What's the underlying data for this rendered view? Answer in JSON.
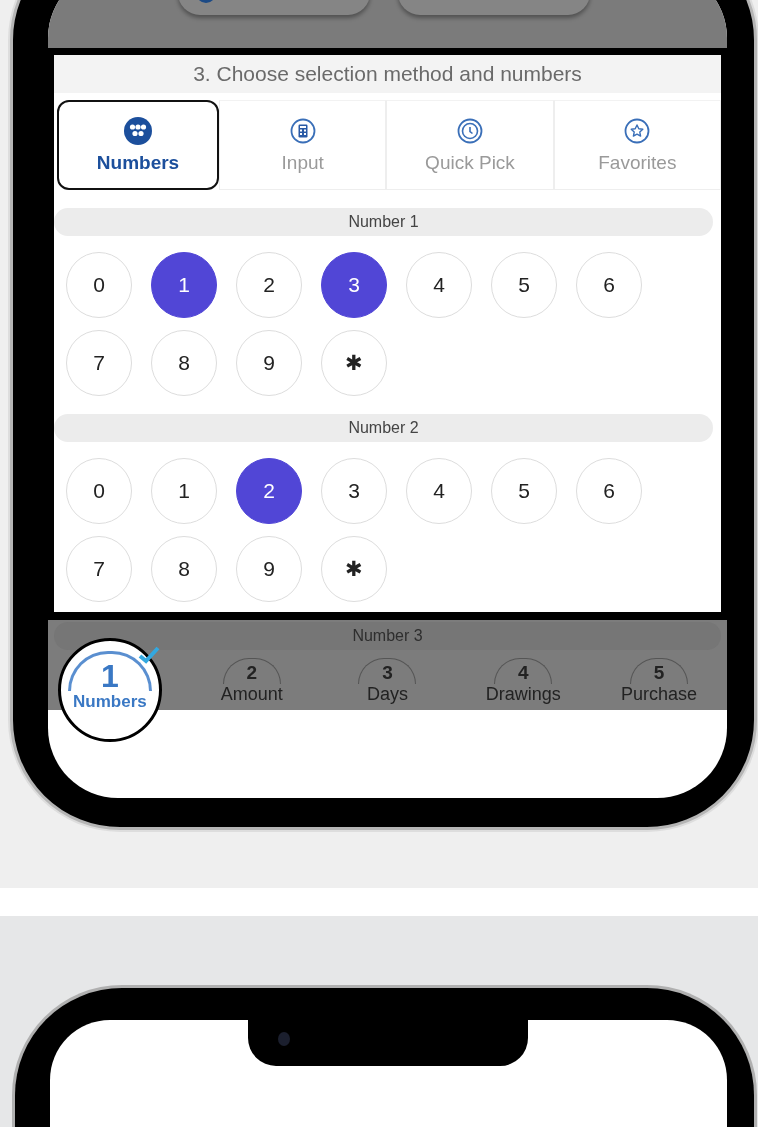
{
  "dimmed_top": {
    "buttons": [
      {
        "kind": "icon"
      },
      {
        "kind": "plain"
      }
    ]
  },
  "highlighted_section": {
    "title": "3. Choose selection method and numbers",
    "tabs": [
      {
        "label": "Numbers",
        "kind": "numbers",
        "selected": true
      },
      {
        "label": "Input",
        "kind": "input",
        "selected": false
      },
      {
        "label": "Quick Pick",
        "kind": "quick_pick",
        "selected": false
      },
      {
        "label": "Favorites",
        "kind": "favorites",
        "selected": false
      }
    ],
    "number_groups": [
      {
        "label": "Number 1",
        "options": [
          {
            "label": "0",
            "selected": false
          },
          {
            "label": "1",
            "selected": true
          },
          {
            "label": "2",
            "selected": false
          },
          {
            "label": "3",
            "selected": true
          },
          {
            "label": "4",
            "selected": false
          },
          {
            "label": "5",
            "selected": false
          },
          {
            "label": "6",
            "selected": false
          },
          {
            "label": "7",
            "selected": false
          },
          {
            "label": "8",
            "selected": false
          },
          {
            "label": "9",
            "selected": false
          },
          {
            "label": "✱",
            "selected": false
          }
        ]
      },
      {
        "label": "Number 2",
        "options": [
          {
            "label": "0",
            "selected": false
          },
          {
            "label": "1",
            "selected": false
          },
          {
            "label": "2",
            "selected": true
          },
          {
            "label": "3",
            "selected": false
          },
          {
            "label": "4",
            "selected": false
          },
          {
            "label": "5",
            "selected": false
          },
          {
            "label": "6",
            "selected": false
          },
          {
            "label": "7",
            "selected": false
          },
          {
            "label": "8",
            "selected": false
          },
          {
            "label": "9",
            "selected": false
          },
          {
            "label": "✱",
            "selected": false
          }
        ]
      }
    ]
  },
  "dimmed_bottom": {
    "group_label": "Number 3",
    "steps": [
      {
        "number": "1",
        "label": "Numbers",
        "selected": true,
        "completed": true
      },
      {
        "number": "2",
        "label": "Amount",
        "selected": false,
        "completed": false
      },
      {
        "number": "3",
        "label": "Days",
        "selected": false,
        "completed": false
      },
      {
        "number": "4",
        "label": "Drawings",
        "selected": false,
        "completed": false
      },
      {
        "number": "5",
        "label": "Purchase",
        "selected": false,
        "completed": false
      }
    ]
  }
}
